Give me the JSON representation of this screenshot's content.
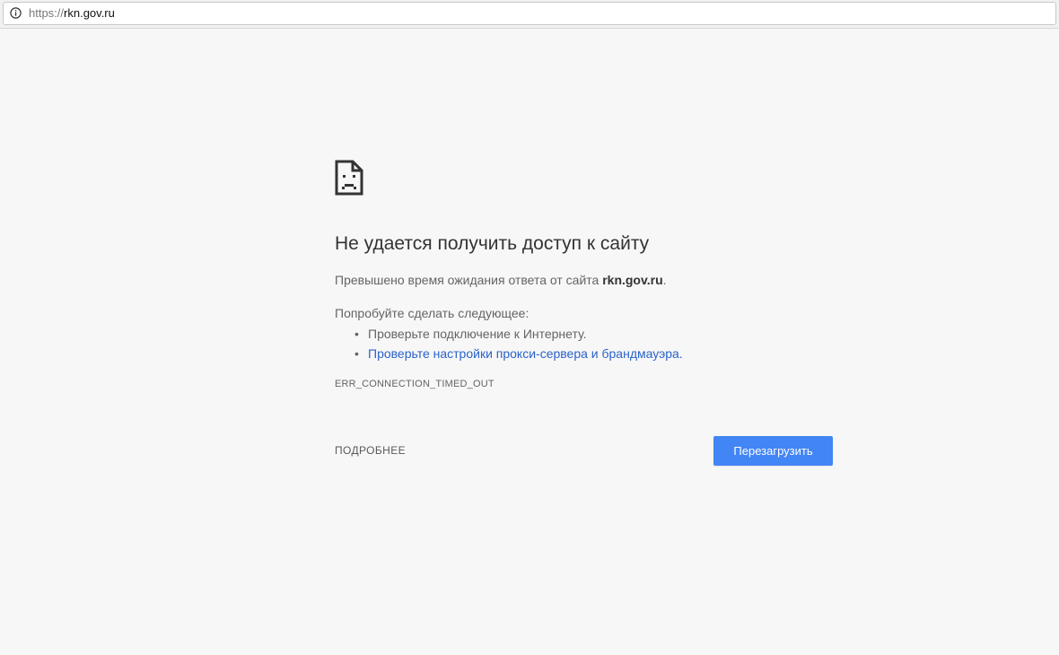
{
  "address_bar": {
    "scheme": "https://",
    "host": "rkn.gov.ru",
    "icon": "info-icon"
  },
  "error_page": {
    "icon": "sad-document-icon",
    "heading": "Не удается получить доступ к сайту",
    "summary_prefix": "Превышено время ожидания ответа от сайта ",
    "summary_host": "rkn.gov.ru",
    "summary_suffix": ".",
    "suggestions_title": "Попробуйте сделать следующее:",
    "suggestions": [
      {
        "text": "Проверьте подключение к Интернету.",
        "is_link": false
      },
      {
        "text": "Проверьте настройки прокси-сервера и брандмауэра.",
        "is_link": true
      }
    ],
    "bullet": "•",
    "error_code": "ERR_CONNECTION_TIMED_OUT",
    "details_label": "ПОДРОБНЕЕ",
    "reload_label": "Перезагрузить"
  },
  "colors": {
    "background": "#f7f7f7",
    "primary_button": "#4285f4",
    "link": "#2a62c9",
    "text_secondary": "#646464",
    "text_primary": "#333333"
  }
}
